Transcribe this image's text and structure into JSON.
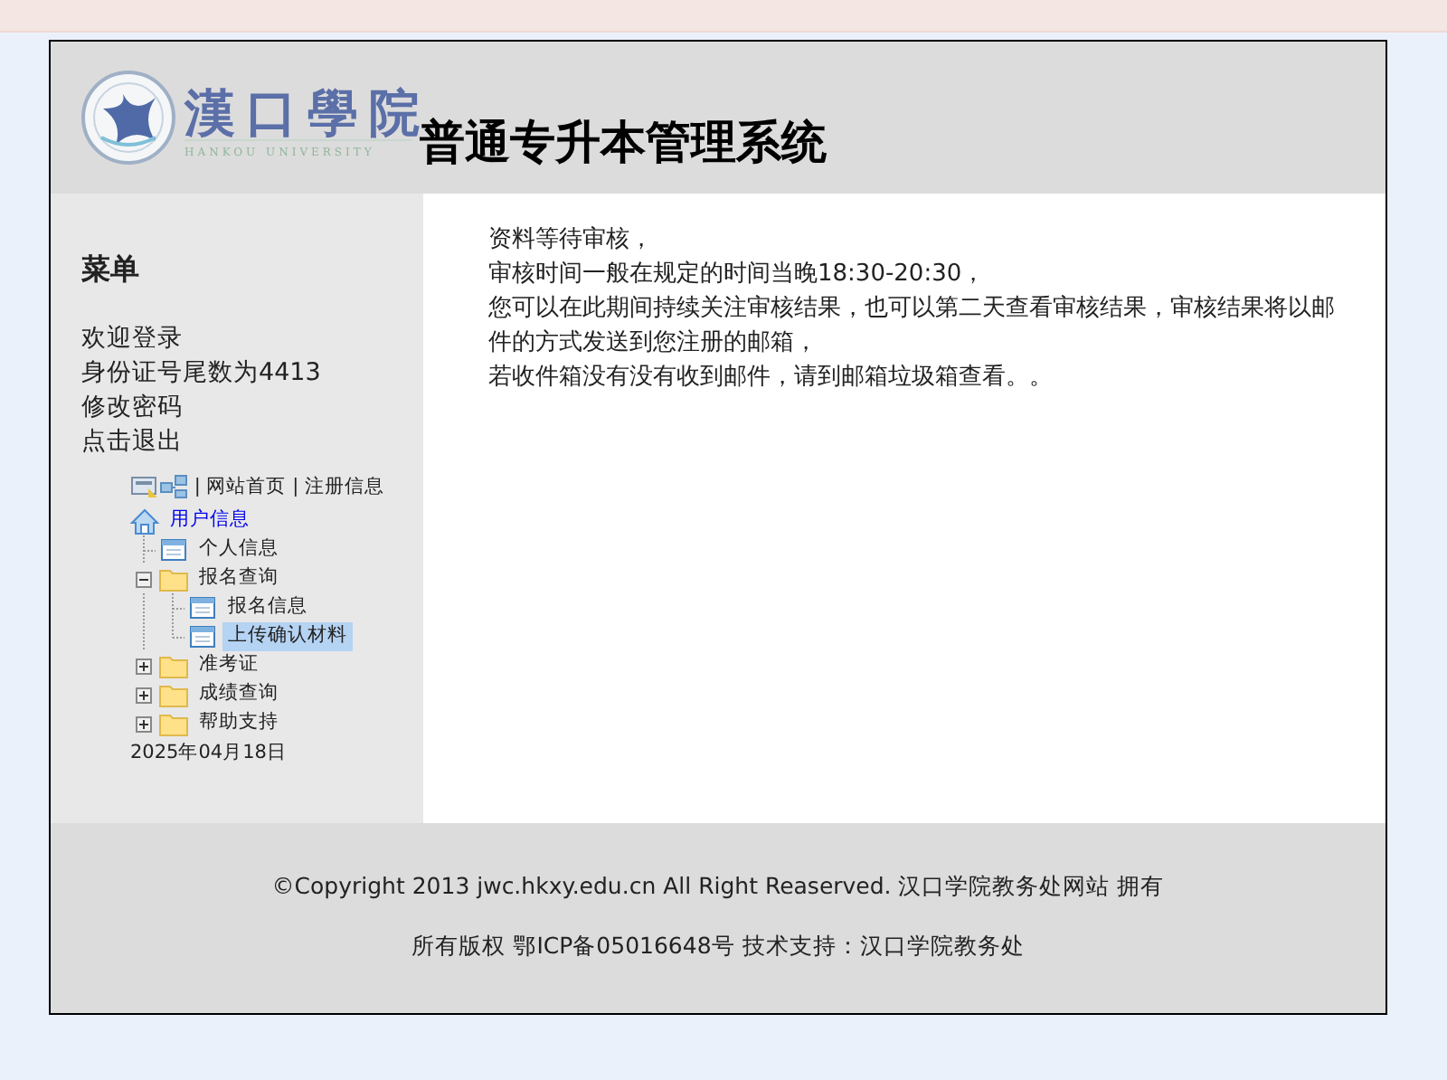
{
  "header": {
    "logo_name": "漢口學院",
    "logo_subtitle": "HANKOU UNIVERSITY",
    "title": "普通专升本管理系统"
  },
  "sidebar": {
    "heading": "菜单",
    "lines": [
      "欢迎登录",
      "身份证号尾数为4413",
      "修改密码",
      "点击退出"
    ],
    "toolbar": {
      "links": [
        "网站首页",
        "注册信息"
      ],
      "separator": "|"
    },
    "tree": {
      "root": "用户信息",
      "children": [
        {
          "label": "个人信息",
          "kind": "page",
          "selected": false
        },
        {
          "label": "报名查询",
          "kind": "folder",
          "expanded": true,
          "selected": false,
          "children": [
            {
              "label": "报名信息",
              "kind": "page",
              "selected": false
            },
            {
              "label": "上传确认材料",
              "kind": "page",
              "selected": true
            }
          ]
        },
        {
          "label": "准考证",
          "kind": "folder",
          "expanded": false,
          "selected": false
        },
        {
          "label": "成绩查询",
          "kind": "folder",
          "expanded": false,
          "selected": false
        },
        {
          "label": "帮助支持",
          "kind": "folder",
          "expanded": false,
          "selected": false
        }
      ]
    },
    "date": "2025年04月18日"
  },
  "message": [
    "资料等待审核，",
    "审核时间一般在规定的时间当晚18:30-20:30，",
    "您可以在此期间持续关注审核结果，也可以第二天查看审核结果，审核结果将以邮件的方式发送到您注册的邮箱，",
    "若收件箱没有没有收到邮件，请到邮箱垃圾箱查看。。"
  ],
  "footer": [
    "©Copyright 2013 jwc.hkxy.edu.cn All Right Reaserved. 汉口学院教务处网站 拥有",
    "所有版权 鄂ICP备05016648号 技术支持：汉口学院教务处"
  ]
}
